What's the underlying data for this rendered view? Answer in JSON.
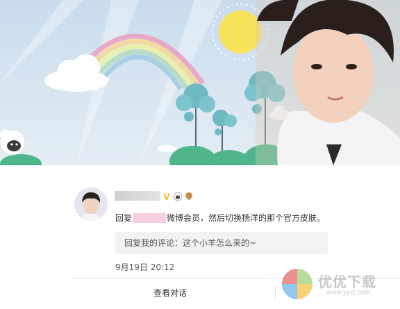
{
  "comment": {
    "reply_prefix": "回复",
    "reply_body": "微博会员，然后切换杨洋的那个官方皮肤。",
    "quoted_text": "回复我的评论：这个小羊怎么来的~",
    "timestamp": "9月19日 20:12"
  },
  "actions": {
    "view_conversation": "查看对话"
  },
  "badges": {
    "vip": "V"
  },
  "watermark": {
    "name": "优优下载",
    "url": "www.yyxt.com"
  },
  "colors": {
    "sky": "#c9dcec",
    "sun": "#f7e25a",
    "tree": "#6fb9c3",
    "hill": "#4fb58a",
    "vip_gold": "#f4b400"
  }
}
